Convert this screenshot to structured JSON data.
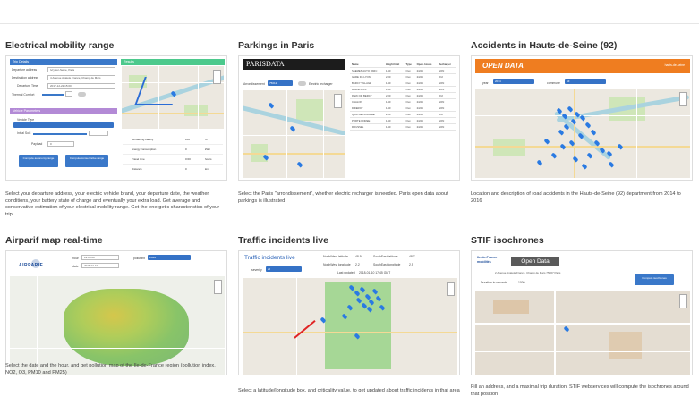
{
  "cards": [
    {
      "title": "Electrical mobility range",
      "description": "Select your departure address, your electric vehicle brand, your departure date, the weather conditions, your battery state of charge and eventually your extra load. Get average and conservative estimation of your electrical mobility range. Get the energetic characteristics of your trip",
      "thumb": {
        "trip_details_header": "Trip Details",
        "results_header": "Results",
        "departure_label": "Departure address",
        "departure_value": "Ivry-sur-Seine, Paris",
        "destination_label": "Destination address",
        "destination_value": "4 Avenue Anatole France, Champ de Mars",
        "date_label": "Departure Time",
        "date_value": "2017-12-22 15:00",
        "comfort_label": "Thermal Comfort",
        "params_header": "Vehicle Parameters",
        "vehicle_label": "Vehicle Type",
        "initial_label": "Initial SoC",
        "payload_label": "Payload",
        "payload_value": "0",
        "btn_compute": "Compute autonomy range",
        "btn_compute_cons": "Compute conservative range",
        "result_rows": [
          {
            "label": "Remaining battery",
            "value": "100",
            "unit": "%"
          },
          {
            "label": "Energy consumption",
            "value": "0",
            "unit": "kWh"
          },
          {
            "label": "Travel time",
            "value": "0:00",
            "unit": "hours"
          },
          {
            "label": "Distance",
            "value": "0",
            "unit": "km"
          }
        ]
      }
    },
    {
      "title": "Parkings in Paris",
      "description": "Select the Paris \"arrondissement\", whether electric recharger is needed. Paris open data about parkings is illustrated",
      "thumb": {
        "banner": "PARISDATA",
        "arrondissement_label": "Arrondissement",
        "select_value": "75012",
        "recharger_label": "Electric recharger",
        "table_headers": [
          "Name",
          "Height limit",
          "Type",
          "Open. Hours",
          "Recharger"
        ],
        "table_rows": [
          [
            "SAEMES AUTO PARC",
            "1.90",
            "Ouv",
            "24/24",
            "NON"
          ],
          [
            "GARE DE LYON",
            "2.00",
            "Ouv",
            "24/24",
            "OUI"
          ],
          [
            "BERCY VILLAGE",
            "1.90",
            "Ouv",
            "24/24",
            "NON"
          ],
          [
            "HALLE BOIS",
            "1.90",
            "Ouv",
            "24/24",
            "NON"
          ],
          [
            "PARC DE BERCY",
            "2.00",
            "Ouv",
            "24/24",
            "OUI"
          ],
          [
            "CHALON",
            "1.90",
            "Ouv",
            "24/24",
            "NON"
          ],
          [
            "DIDEROT",
            "1.90",
            "Ouv",
            "24/24",
            "NON"
          ],
          [
            "QUAI DE LA RAPEE",
            "2.00",
            "Ouv",
            "24/24",
            "OUI"
          ],
          [
            "PORTE DOREE",
            "1.90",
            "Ouv",
            "24/24",
            "NON"
          ],
          [
            "ROUSSEL",
            "1.90",
            "Ouv",
            "24/24",
            "NON"
          ]
        ]
      }
    },
    {
      "title": "Accidents in Hauts-de-Seine (92)",
      "description": "Location and description of road accidents in the Hauts-de-Seine (92) department from 2014 to 2016",
      "thumb": {
        "banner": "OPEN DATA",
        "badge": "hauts-de-seine",
        "year_label": "year",
        "year_value": "2014",
        "commune_label": "commune",
        "commune_value": "All"
      }
    },
    {
      "title": "Airparif map real-time",
      "description": "Select the date and the hour, and get pollution map of the Ile-de-France region (pollution index, NO2, O3, PM10 and PM25)",
      "thumb": {
        "logo": "AIRPARIF",
        "hour_label": "hour",
        "hour_value": "12:00:00",
        "date_label": "date",
        "date_value": "2018-01-10",
        "pollutant_label": "pollutant",
        "pollutant_value": "index"
      }
    },
    {
      "title": "Traffic incidents live",
      "description": "Select a latitude/longitude box, and criticality value, to get updated about traffic incidents in that area",
      "thumb": {
        "header": "Traffic incidents live",
        "severity_label": "severity",
        "severity_value": "all",
        "nw_lat_label": "NorthWest latitude",
        "nw_lat_value": "48.9",
        "nw_lon_label": "NorthWest longitude",
        "nw_lon_value": "2.2",
        "se_lat_label": "SouthEast latitude",
        "se_lat_value": "48.7",
        "se_lon_label": "SouthEast longitude",
        "se_lon_value": "2.5",
        "updated_label": "Last updated",
        "updated_value": "2018-01-10 17:45 GMT"
      }
    },
    {
      "title": "STIF isochrones",
      "description": "Fill an address, and a maximal trip duration. STIF webservices will compute the isochrones around that position",
      "thumb": {
        "brand": "Ile-de-France mobilités",
        "open_data": "Open Data",
        "address_value": "2 Avenue Anatole France, Champ de Mars 75007 Paris",
        "duration_label": "Duration in seconds",
        "duration_value": "1000",
        "compute_button": "Compute isochrones"
      }
    }
  ]
}
